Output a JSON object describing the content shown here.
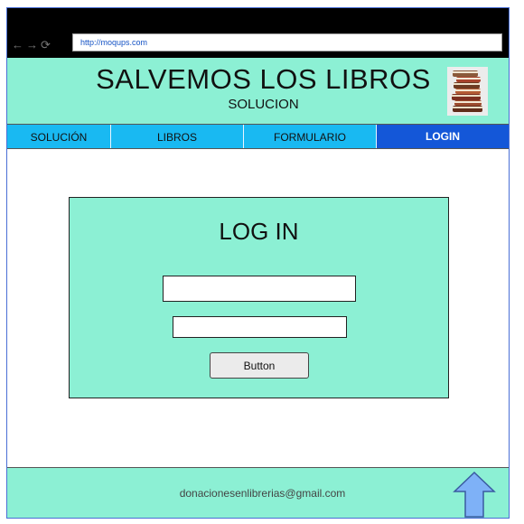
{
  "browser": {
    "url": "http://moqups.com",
    "back_icon": "arrow-left-icon",
    "forward_icon": "arrow-right-icon",
    "reload_icon": "reload-icon"
  },
  "header": {
    "title": "SALVEMOS LOS LIBROS",
    "subtitle": "SOLUCION",
    "logo_icon": "stacked-books-icon",
    "background": "#8cf0d4"
  },
  "menu": {
    "items": [
      {
        "label": "SOLUCIÓN"
      },
      {
        "label": "LIBROS"
      },
      {
        "label": "FORMULARIO"
      },
      {
        "label": "LOGIN",
        "active": true
      }
    ],
    "background": "#19b9f2",
    "active_background": "#1457d8"
  },
  "login": {
    "title": "LOG IN",
    "field_one_value": "",
    "field_two_value": "",
    "button_label": "Button",
    "background": "#8cf0d4"
  },
  "footer": {
    "email": "donacionesenlibrerias@gmail.com",
    "scroll_top_icon": "arrow-up-icon",
    "arrow_color": "#7eb1f7"
  }
}
